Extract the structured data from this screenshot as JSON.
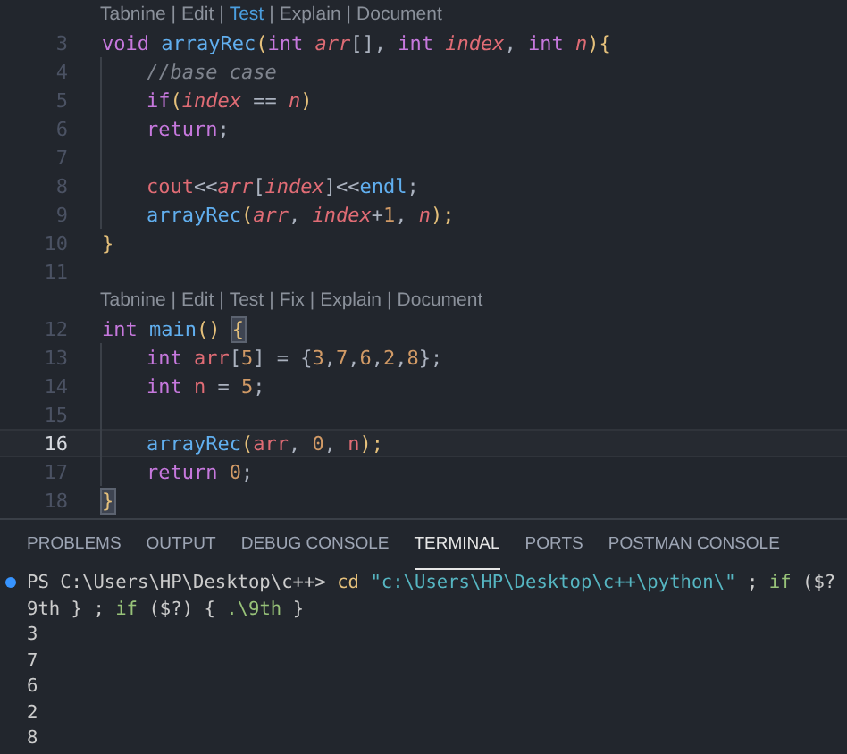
{
  "editor": {
    "rows": [
      {
        "kind": "codelens",
        "separator": "|",
        "items": [
          {
            "label": "Tabnine",
            "selected": false
          },
          {
            "label": "Edit",
            "selected": false
          },
          {
            "label": "Test",
            "selected": true
          },
          {
            "label": "Explain",
            "selected": false
          },
          {
            "label": "Document",
            "selected": false
          }
        ]
      },
      {
        "kind": "line",
        "number": "3",
        "current": false,
        "guide": false,
        "tokens": [
          {
            "text": "void ",
            "kind": "keyword"
          },
          {
            "text": "arrayRec",
            "kind": "function"
          },
          {
            "text": "(",
            "kind": "bracket"
          },
          {
            "text": "int ",
            "kind": "keyword"
          },
          {
            "text": "arr",
            "kind": "param"
          },
          {
            "text": "[], ",
            "kind": "plain"
          },
          {
            "text": "int ",
            "kind": "keyword"
          },
          {
            "text": "index",
            "kind": "param"
          },
          {
            "text": ", ",
            "kind": "plain"
          },
          {
            "text": "int ",
            "kind": "keyword"
          },
          {
            "text": "n",
            "kind": "param"
          },
          {
            "text": "){",
            "kind": "bracket"
          }
        ]
      },
      {
        "kind": "line",
        "number": "4",
        "current": false,
        "guide": true,
        "tokens": [
          {
            "text": "//base case",
            "kind": "comment"
          }
        ]
      },
      {
        "kind": "line",
        "number": "5",
        "current": false,
        "guide": true,
        "tokens": [
          {
            "text": "if",
            "kind": "control"
          },
          {
            "text": "(",
            "kind": "bracket"
          },
          {
            "text": "index",
            "kind": "param"
          },
          {
            "text": " == ",
            "kind": "plain"
          },
          {
            "text": "n",
            "kind": "param"
          },
          {
            "text": ")",
            "kind": "bracket"
          }
        ]
      },
      {
        "kind": "line",
        "number": "6",
        "current": false,
        "guide": true,
        "tokens": [
          {
            "text": "return",
            "kind": "control"
          },
          {
            "text": ";",
            "kind": "plain"
          }
        ]
      },
      {
        "kind": "line",
        "number": "7",
        "current": false,
        "guide": true,
        "tokens": []
      },
      {
        "kind": "line",
        "number": "8",
        "current": false,
        "guide": true,
        "tokens": [
          {
            "text": "cout",
            "kind": "variable"
          },
          {
            "text": "<<",
            "kind": "plain"
          },
          {
            "text": "arr",
            "kind": "param"
          },
          {
            "text": "[",
            "kind": "plain"
          },
          {
            "text": "index",
            "kind": "param"
          },
          {
            "text": "]<<",
            "kind": "plain"
          },
          {
            "text": "endl",
            "kind": "function"
          },
          {
            "text": ";",
            "kind": "plain"
          }
        ]
      },
      {
        "kind": "line",
        "number": "9",
        "current": false,
        "guide": true,
        "tokens": [
          {
            "text": "arrayRec",
            "kind": "function"
          },
          {
            "text": "(",
            "kind": "bracket"
          },
          {
            "text": "arr",
            "kind": "param"
          },
          {
            "text": ", ",
            "kind": "plain"
          },
          {
            "text": "index",
            "kind": "param"
          },
          {
            "text": "+",
            "kind": "plain"
          },
          {
            "text": "1",
            "kind": "number"
          },
          {
            "text": ", ",
            "kind": "plain"
          },
          {
            "text": "n",
            "kind": "param"
          },
          {
            "text": ");",
            "kind": "bracket"
          }
        ]
      },
      {
        "kind": "line",
        "number": "10",
        "current": false,
        "guide": false,
        "tokens": [
          {
            "text": "}",
            "kind": "bracket"
          }
        ]
      },
      {
        "kind": "line",
        "number": "11",
        "current": false,
        "guide": false,
        "tokens": []
      },
      {
        "kind": "codelens",
        "separator": "|",
        "items": [
          {
            "label": "Tabnine",
            "selected": false
          },
          {
            "label": "Edit",
            "selected": false
          },
          {
            "label": "Test",
            "selected": false
          },
          {
            "label": "Fix",
            "selected": false
          },
          {
            "label": "Explain",
            "selected": false
          },
          {
            "label": "Document",
            "selected": false
          }
        ]
      },
      {
        "kind": "line",
        "number": "12",
        "current": false,
        "guide": false,
        "tokens": [
          {
            "text": "int ",
            "kind": "keyword"
          },
          {
            "text": "main",
            "kind": "function"
          },
          {
            "text": "() ",
            "kind": "bracket"
          },
          {
            "text": "{",
            "kind": "match"
          }
        ]
      },
      {
        "kind": "line",
        "number": "13",
        "current": false,
        "guide": true,
        "tokens": [
          {
            "text": "int ",
            "kind": "keyword"
          },
          {
            "text": "arr",
            "kind": "variable"
          },
          {
            "text": "[",
            "kind": "plain"
          },
          {
            "text": "5",
            "kind": "number"
          },
          {
            "text": "] = {",
            "kind": "plain"
          },
          {
            "text": "3",
            "kind": "number"
          },
          {
            "text": ",",
            "kind": "plain"
          },
          {
            "text": "7",
            "kind": "number"
          },
          {
            "text": ",",
            "kind": "plain"
          },
          {
            "text": "6",
            "kind": "number"
          },
          {
            "text": ",",
            "kind": "plain"
          },
          {
            "text": "2",
            "kind": "number"
          },
          {
            "text": ",",
            "kind": "plain"
          },
          {
            "text": "8",
            "kind": "number"
          },
          {
            "text": "};",
            "kind": "plain"
          }
        ]
      },
      {
        "kind": "line",
        "number": "14",
        "current": false,
        "guide": true,
        "tokens": [
          {
            "text": "int ",
            "kind": "keyword"
          },
          {
            "text": "n",
            "kind": "variable"
          },
          {
            "text": " = ",
            "kind": "plain"
          },
          {
            "text": "5",
            "kind": "number"
          },
          {
            "text": ";",
            "kind": "plain"
          }
        ]
      },
      {
        "kind": "line",
        "number": "15",
        "current": false,
        "guide": true,
        "tokens": []
      },
      {
        "kind": "line",
        "number": "16",
        "current": true,
        "guide": true,
        "tokens": [
          {
            "text": "arrayRec",
            "kind": "function"
          },
          {
            "text": "(",
            "kind": "bracket"
          },
          {
            "text": "arr",
            "kind": "variable"
          },
          {
            "text": ", ",
            "kind": "plain"
          },
          {
            "text": "0",
            "kind": "number"
          },
          {
            "text": ", ",
            "kind": "plain"
          },
          {
            "text": "n",
            "kind": "variable"
          },
          {
            "text": ");",
            "kind": "bracket"
          }
        ]
      },
      {
        "kind": "line",
        "number": "17",
        "current": false,
        "guide": true,
        "tokens": [
          {
            "text": "return ",
            "kind": "control"
          },
          {
            "text": "0",
            "kind": "number"
          },
          {
            "text": ";",
            "kind": "plain"
          }
        ]
      },
      {
        "kind": "line",
        "number": "18",
        "current": false,
        "guide": false,
        "tokens": [
          {
            "text": "}",
            "kind": "match"
          }
        ]
      }
    ]
  },
  "panel": {
    "tabs": [
      {
        "label": "PROBLEMS",
        "selected": false
      },
      {
        "label": "OUTPUT",
        "selected": false
      },
      {
        "label": "DEBUG CONSOLE",
        "selected": false
      },
      {
        "label": "TERMINAL",
        "selected": true
      },
      {
        "label": "PORTS",
        "selected": false
      },
      {
        "label": "POSTMAN CONSOLE",
        "selected": false
      }
    ],
    "terminal": [
      {
        "marker": true,
        "tokens": [
          {
            "text": "PS C:\\Users\\HP\\Desktop\\c++> ",
            "kind": "plain"
          },
          {
            "text": "cd ",
            "kind": "command"
          },
          {
            "text": "\"c:\\Users\\HP\\Desktop\\c++\\python\\\"",
            "kind": "string"
          },
          {
            "text": " ; ",
            "kind": "plain"
          },
          {
            "text": "if ",
            "kind": "keyword"
          },
          {
            "text": "($?",
            "kind": "plain"
          }
        ]
      },
      {
        "marker": false,
        "tokens": [
          {
            "text": "9th } ; ",
            "kind": "plain"
          },
          {
            "text": "if ",
            "kind": "keyword"
          },
          {
            "text": "($?) { ",
            "kind": "plain"
          },
          {
            "text": ".\\9th",
            "kind": "keyword"
          },
          {
            "text": " }",
            "kind": "plain"
          }
        ]
      },
      {
        "marker": false,
        "tokens": [
          {
            "text": "3",
            "kind": "plain"
          }
        ]
      },
      {
        "marker": false,
        "tokens": [
          {
            "text": "7",
            "kind": "plain"
          }
        ]
      },
      {
        "marker": false,
        "tokens": [
          {
            "text": "6",
            "kind": "plain"
          }
        ]
      },
      {
        "marker": false,
        "tokens": [
          {
            "text": "2",
            "kind": "plain"
          }
        ]
      },
      {
        "marker": false,
        "tokens": [
          {
            "text": "8",
            "kind": "plain"
          }
        ]
      }
    ]
  }
}
